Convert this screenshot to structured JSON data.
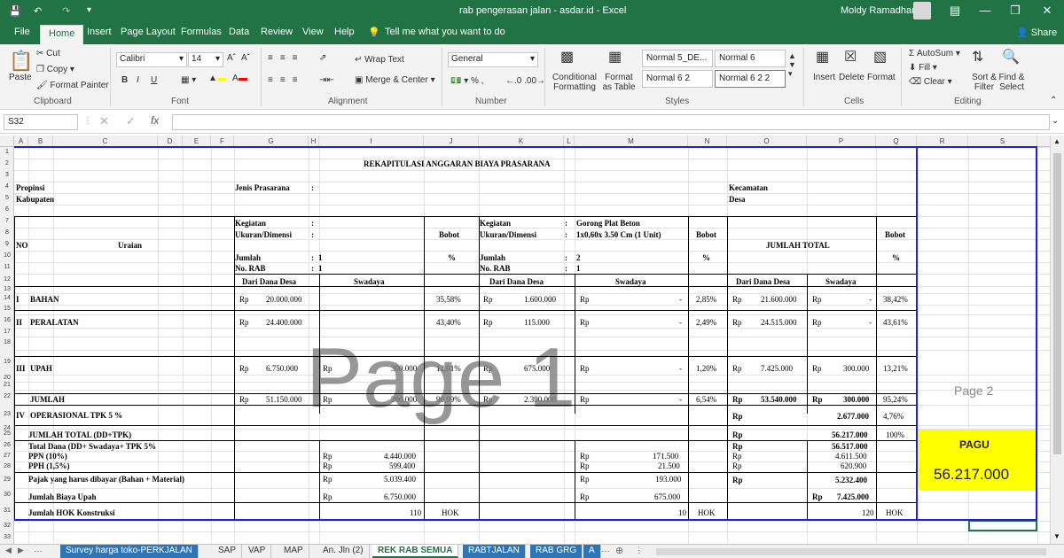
{
  "window": {
    "title": "rab pengerasan jalan - asdar.id  -  Excel",
    "user": "Moldy Ramadhan",
    "share": "Share"
  },
  "tabs": [
    "File",
    "Home",
    "Insert",
    "Page Layout",
    "Formulas",
    "Data",
    "Review",
    "View",
    "Help"
  ],
  "tell_me": "Tell me what you want to do",
  "ribbon": {
    "clipboard": {
      "paste": "Paste",
      "cut": "Cut",
      "copy": "Copy",
      "painter": "Format Painter",
      "group": "Clipboard"
    },
    "font": {
      "name": "Calibri",
      "size": "14",
      "group": "Font"
    },
    "alignment": {
      "wrap": "Wrap Text",
      "merge": "Merge & Center",
      "group": "Alignment"
    },
    "number": {
      "format": "General",
      "group": "Number"
    },
    "styles": {
      "cond": "Conditional Formatting",
      "fmt_table": "Format as Table",
      "s1": "Normal 5_DE...",
      "s2": "Normal 6",
      "s3": "Normal 6 2",
      "s4": "Normal 6 2 2",
      "group": "Styles"
    },
    "cells": {
      "insert": "Insert",
      "delete": "Delete",
      "format": "Format",
      "group": "Cells"
    },
    "editing": {
      "autosum": "AutoSum",
      "fill": "Fill",
      "clear": "Clear",
      "sort": "Sort & Filter",
      "find": "Find & Select",
      "group": "Editing"
    }
  },
  "namebox": "S32",
  "fx": "fx",
  "columns": [
    "A",
    "B",
    "C",
    "D",
    "E",
    "F",
    "G",
    "H",
    "I",
    "J",
    "K",
    "L",
    "M",
    "N",
    "O",
    "P",
    "Q",
    "R",
    "S"
  ],
  "rows": [
    "1",
    "2",
    "3",
    "4",
    "5",
    "6",
    "7",
    "8",
    "9",
    "10",
    "11",
    "12",
    "13",
    "14",
    "15",
    "16",
    "17",
    "18",
    "19",
    "20",
    "21",
    "22",
    "23",
    "24",
    "25",
    "26",
    "27",
    "28",
    "29",
    "30",
    "31",
    "32",
    "33"
  ],
  "sheet": {
    "title": "REKAPITULASI ANGGARAN BIAYA PRASARANA",
    "propinsi": "Propinsi",
    "kabupaten": "Kabupaten",
    "jenis": "Jenis Prasarana",
    "colon": ":",
    "kecamatan": "Kecamatan",
    "desa": "Desa",
    "no": "NO",
    "uraian": "Uraian",
    "kegiatan": "Kegiatan",
    "ukuran": "Ukuran/Dimensi",
    "jumlah": "Jumlah",
    "norab": "No. RAB",
    "jumlah_val1": "1",
    "norab_val1": "1",
    "jumlah_val2": "2",
    "norab_val2": "1",
    "keg2": "Gorong Plat Beton",
    "uk2": "1x0,60x 3.50 Cm (1 Unit)",
    "bobot": "Bobot",
    "pct": "%",
    "jt": "JUMLAH TOTAL",
    "dari": "Dari Dana Desa",
    "swadaya": "Swadaya",
    "rows": [
      {
        "no": "I",
        "label": "BAHAN",
        "g": "20.000.000",
        "i": "",
        "j": "35,58%",
        "l": "1.600.000",
        "m": "-",
        "n": "2,85%",
        "o": "21.600.000",
        "p": "-",
        "q": "38,42%"
      },
      {
        "no": "II",
        "label": "PERALATAN",
        "g": "24.400.000",
        "i": "",
        "j": "43,40%",
        "l": "115.000",
        "m": "-",
        "n": "2,49%",
        "o": "24.515.000",
        "p": "-",
        "q": "43,61%"
      },
      {
        "no": "III",
        "label": "UPAH",
        "g": "6.750.000",
        "i": "300.000",
        "j": "12,01%",
        "l": "675.000",
        "m": "-",
        "n": "1,20%",
        "o": "7.425.000",
        "p": "300.000",
        "q": "13,21%"
      },
      {
        "no": "",
        "label": "JUMLAH",
        "g": "51.150.000",
        "i": "300.000",
        "j": "90,99%",
        "l": "2.390.000",
        "m": "-",
        "n": "6,54%",
        "o": "53.540.000",
        "p": "300.000",
        "q": "95,24%"
      }
    ],
    "rp": "Rp",
    "op_no": "IV",
    "op": "OPERASIONAL TPK 5 %",
    "op_val": "2.677.000",
    "op_pct": "4,76%",
    "jt_label": "JUMLAH TOTAL (DD+TPK)",
    "jt_val": "56.217.000",
    "jt_pct": "100%",
    "td_label": "Total Dana (DD+ Swadaya+ TPK 5%",
    "td_val": "56.517.000",
    "ppn_label": "PPN (10%)",
    "ppn1": "4.440.000",
    "ppn2": "171.500",
    "ppn3": "4.611.500",
    "pph_label": "PPH (1,5%)",
    "pph1": "599.400",
    "pph2": "21.500",
    "pph3": "620.900",
    "pajak_label": "Pajak yang harus dibayar (Bahan + Material)",
    "pajak1": "5.039.400",
    "pajak2": "193.000",
    "pajak3": "5.232.400",
    "upah_label": "Jumlah Biaya Upah",
    "upah1": "6.750.000",
    "upah2": "675.000",
    "upah3": "7.425.000",
    "hok_label": "Jumlah HOK Konstruksi",
    "hok1": "110",
    "hok2": "10",
    "hok3": "120",
    "hok": "HOK"
  },
  "watermark1": "Page 1",
  "watermark2": "Page 2",
  "pagu": {
    "label": "PAGU",
    "value": "56.217.000"
  },
  "sheet_tabs": [
    "Survey harga toko-PERKJALAN",
    "SAP",
    "VAP",
    "MAP",
    "An. Jln (2)",
    "REK RAB SEMUA",
    "RABTJALAN",
    "RAB GRG",
    "A"
  ],
  "colors": {
    "excel_green": "#217346",
    "pagu_yellow": "#ffff00",
    "tab_blue": "#2e75b6"
  }
}
